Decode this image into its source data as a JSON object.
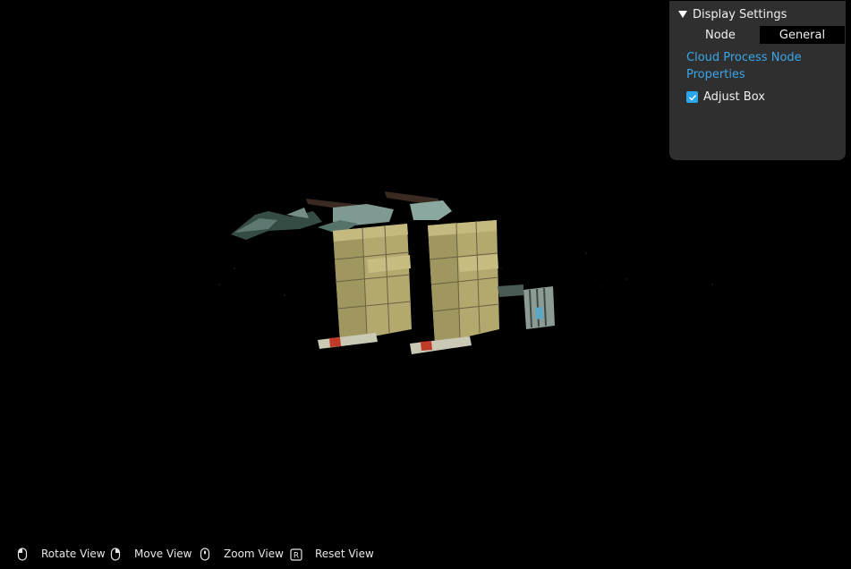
{
  "panel": {
    "title": "Display Settings",
    "node_label": "Node",
    "node_value": "General",
    "properties_link": "Cloud Process Node Properties",
    "adjust_box_label": "Adjust Box",
    "adjust_box_checked": true
  },
  "hints": [
    {
      "icon": "mouse-left-icon",
      "label": "Rotate View"
    },
    {
      "icon": "mouse-right-icon",
      "label": "Move View"
    },
    {
      "icon": "mouse-wheel-icon",
      "label": "Zoom View"
    },
    {
      "icon": "r-key-icon",
      "label": "Reset View"
    }
  ],
  "colors": {
    "background": "#000000",
    "panel": "#2f2f2f",
    "accent": "#39a7ea",
    "checkbox": "#2aa6ec",
    "panel_surface": "#b3a86e"
  }
}
